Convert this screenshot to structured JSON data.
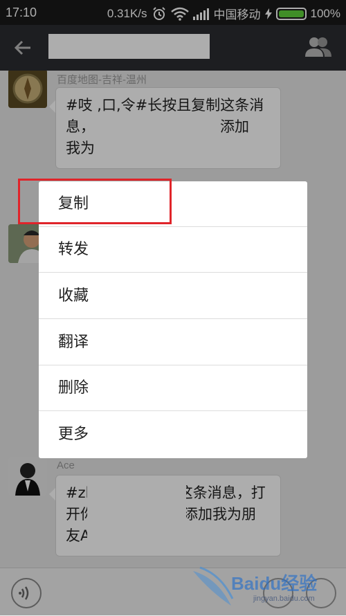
{
  "status_bar": {
    "time": "17:10",
    "speed": "0.31K/s",
    "carrier": "中国移动",
    "battery": "100%",
    "battery_level": 1.0
  },
  "app_bar": {
    "back_icon": "arrow-left-icon",
    "contact_icon": "contacts-icon"
  },
  "messages": [
    {
      "sender": "百度地图-吉祥-温州",
      "text_line1": "#吱 ,口,令#长按且复制这条消",
      "text_line2_start": "息，",
      "text_line2_end": "可添加",
      "text_line3": "我为"
    },
    {
      "sender": "Ace",
      "text_line1": "#zhi 口 令#复制这条消息，打",
      "text_line2_start": "开你",
      "text_line2_end": "添加我为朋",
      "text_line3": "友A"
    }
  ],
  "context_menu": {
    "items": [
      "复制",
      "转发",
      "收藏",
      "翻译",
      "删除",
      "更多"
    ]
  },
  "watermark": {
    "text": "Baidu经验",
    "url": "jingyan.baidu.com"
  },
  "colors": {
    "highlight": "#e0242a",
    "battery_fill": "#5fd13a",
    "app_bar": "#2c2d31"
  }
}
